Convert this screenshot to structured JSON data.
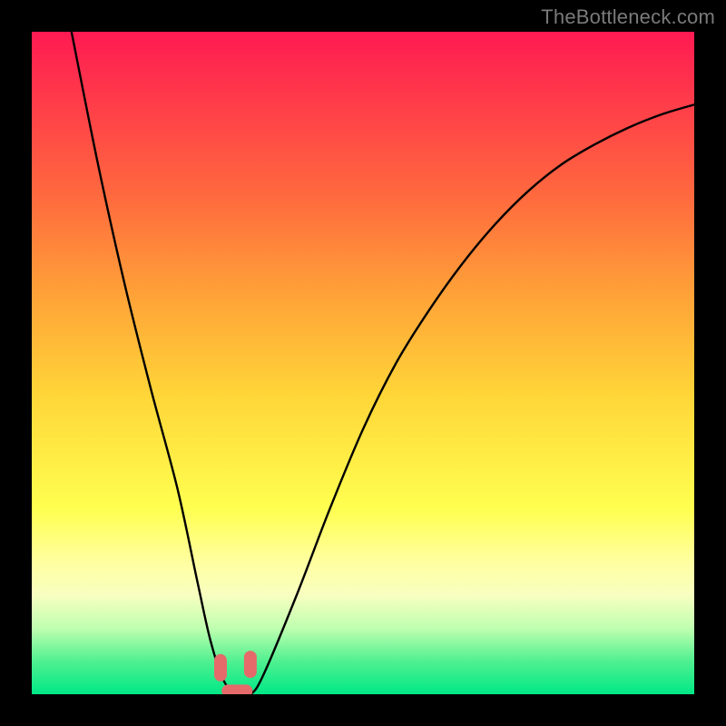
{
  "watermark": "TheBottleneck.com",
  "colors": {
    "background": "#000000",
    "curve": "#000000",
    "marker": "#e56a6a"
  },
  "chart_data": {
    "type": "line",
    "title": "",
    "xlabel": "",
    "ylabel": "",
    "xlim": [
      0,
      100
    ],
    "ylim": [
      0,
      100
    ],
    "grid": false,
    "legend": false,
    "series": [
      {
        "name": "bottleneck-curve",
        "x": [
          6,
          10,
          14,
          18,
          22,
          25,
          27,
          29,
          31,
          33,
          35,
          40,
          45,
          50,
          55,
          60,
          65,
          70,
          75,
          80,
          85,
          90,
          95,
          100
        ],
        "y": [
          100,
          80,
          62,
          46,
          31,
          17,
          8,
          2,
          0,
          0,
          3,
          15,
          28,
          40,
          50,
          58,
          65,
          71,
          76,
          80,
          83,
          85.5,
          87.5,
          89
        ]
      }
    ],
    "annotations": [
      {
        "name": "min-marker-left",
        "x": 28.5,
        "y": 4
      },
      {
        "name": "min-marker-right",
        "x": 33,
        "y": 4.5
      },
      {
        "name": "min-marker-base",
        "x": 31,
        "y": 0.5
      }
    ]
  }
}
